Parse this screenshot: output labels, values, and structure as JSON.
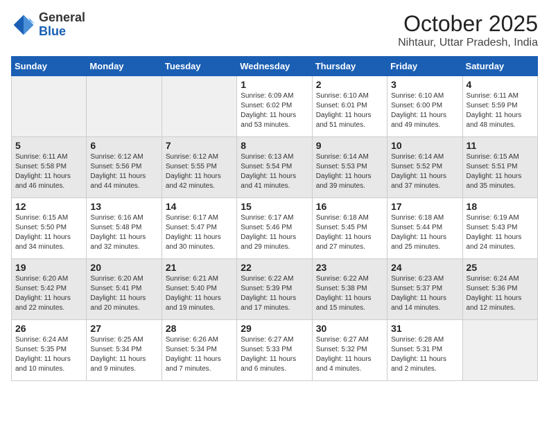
{
  "header": {
    "logo_general": "General",
    "logo_blue": "Blue",
    "month_title": "October 2025",
    "location": "Nihtaur, Uttar Pradesh, India"
  },
  "days_of_week": [
    "Sunday",
    "Monday",
    "Tuesday",
    "Wednesday",
    "Thursday",
    "Friday",
    "Saturday"
  ],
  "weeks": [
    [
      {
        "day": "",
        "empty": true
      },
      {
        "day": "",
        "empty": true
      },
      {
        "day": "",
        "empty": true
      },
      {
        "day": "1",
        "sunrise": "6:09 AM",
        "sunset": "6:02 PM",
        "daylight": "11 hours and 53 minutes."
      },
      {
        "day": "2",
        "sunrise": "6:10 AM",
        "sunset": "6:01 PM",
        "daylight": "11 hours and 51 minutes."
      },
      {
        "day": "3",
        "sunrise": "6:10 AM",
        "sunset": "6:00 PM",
        "daylight": "11 hours and 49 minutes."
      },
      {
        "day": "4",
        "sunrise": "6:11 AM",
        "sunset": "5:59 PM",
        "daylight": "11 hours and 48 minutes."
      }
    ],
    [
      {
        "day": "5",
        "sunrise": "6:11 AM",
        "sunset": "5:58 PM",
        "daylight": "11 hours and 46 minutes."
      },
      {
        "day": "6",
        "sunrise": "6:12 AM",
        "sunset": "5:56 PM",
        "daylight": "11 hours and 44 minutes."
      },
      {
        "day": "7",
        "sunrise": "6:12 AM",
        "sunset": "5:55 PM",
        "daylight": "11 hours and 42 minutes."
      },
      {
        "day": "8",
        "sunrise": "6:13 AM",
        "sunset": "5:54 PM",
        "daylight": "11 hours and 41 minutes."
      },
      {
        "day": "9",
        "sunrise": "6:14 AM",
        "sunset": "5:53 PM",
        "daylight": "11 hours and 39 minutes."
      },
      {
        "day": "10",
        "sunrise": "6:14 AM",
        "sunset": "5:52 PM",
        "daylight": "11 hours and 37 minutes."
      },
      {
        "day": "11",
        "sunrise": "6:15 AM",
        "sunset": "5:51 PM",
        "daylight": "11 hours and 35 minutes."
      }
    ],
    [
      {
        "day": "12",
        "sunrise": "6:15 AM",
        "sunset": "5:50 PM",
        "daylight": "11 hours and 34 minutes."
      },
      {
        "day": "13",
        "sunrise": "6:16 AM",
        "sunset": "5:48 PM",
        "daylight": "11 hours and 32 minutes."
      },
      {
        "day": "14",
        "sunrise": "6:17 AM",
        "sunset": "5:47 PM",
        "daylight": "11 hours and 30 minutes."
      },
      {
        "day": "15",
        "sunrise": "6:17 AM",
        "sunset": "5:46 PM",
        "daylight": "11 hours and 29 minutes."
      },
      {
        "day": "16",
        "sunrise": "6:18 AM",
        "sunset": "5:45 PM",
        "daylight": "11 hours and 27 minutes."
      },
      {
        "day": "17",
        "sunrise": "6:18 AM",
        "sunset": "5:44 PM",
        "daylight": "11 hours and 25 minutes."
      },
      {
        "day": "18",
        "sunrise": "6:19 AM",
        "sunset": "5:43 PM",
        "daylight": "11 hours and 24 minutes."
      }
    ],
    [
      {
        "day": "19",
        "sunrise": "6:20 AM",
        "sunset": "5:42 PM",
        "daylight": "11 hours and 22 minutes."
      },
      {
        "day": "20",
        "sunrise": "6:20 AM",
        "sunset": "5:41 PM",
        "daylight": "11 hours and 20 minutes."
      },
      {
        "day": "21",
        "sunrise": "6:21 AM",
        "sunset": "5:40 PM",
        "daylight": "11 hours and 19 minutes."
      },
      {
        "day": "22",
        "sunrise": "6:22 AM",
        "sunset": "5:39 PM",
        "daylight": "11 hours and 17 minutes."
      },
      {
        "day": "23",
        "sunrise": "6:22 AM",
        "sunset": "5:38 PM",
        "daylight": "11 hours and 15 minutes."
      },
      {
        "day": "24",
        "sunrise": "6:23 AM",
        "sunset": "5:37 PM",
        "daylight": "11 hours and 14 minutes."
      },
      {
        "day": "25",
        "sunrise": "6:24 AM",
        "sunset": "5:36 PM",
        "daylight": "11 hours and 12 minutes."
      }
    ],
    [
      {
        "day": "26",
        "sunrise": "6:24 AM",
        "sunset": "5:35 PM",
        "daylight": "11 hours and 10 minutes."
      },
      {
        "day": "27",
        "sunrise": "6:25 AM",
        "sunset": "5:34 PM",
        "daylight": "11 hours and 9 minutes."
      },
      {
        "day": "28",
        "sunrise": "6:26 AM",
        "sunset": "5:34 PM",
        "daylight": "11 hours and 7 minutes."
      },
      {
        "day": "29",
        "sunrise": "6:27 AM",
        "sunset": "5:33 PM",
        "daylight": "11 hours and 6 minutes."
      },
      {
        "day": "30",
        "sunrise": "6:27 AM",
        "sunset": "5:32 PM",
        "daylight": "11 hours and 4 minutes."
      },
      {
        "day": "31",
        "sunrise": "6:28 AM",
        "sunset": "5:31 PM",
        "daylight": "11 hours and 2 minutes."
      },
      {
        "day": "",
        "empty": true
      }
    ]
  ],
  "labels": {
    "sunrise_prefix": "Sunrise: ",
    "sunset_prefix": "Sunset: ",
    "daylight_prefix": "Daylight: "
  }
}
